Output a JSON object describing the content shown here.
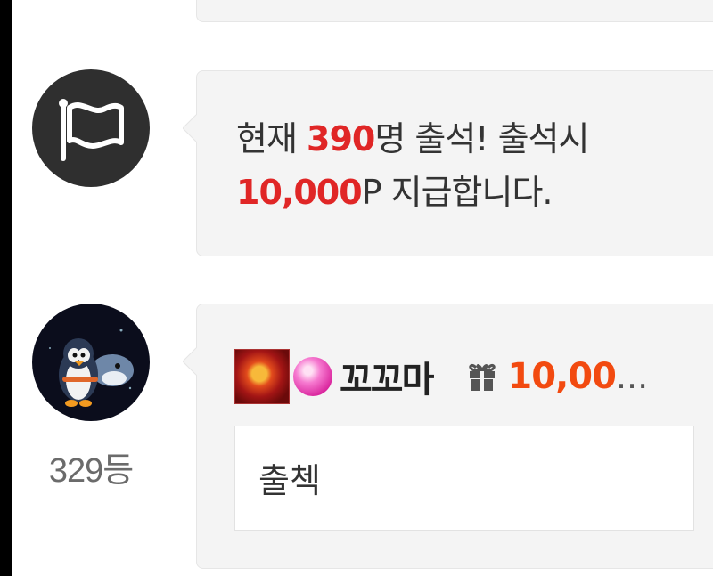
{
  "notice": {
    "icon": "flag-icon",
    "prefix": "현재 ",
    "count": "390",
    "middle": "명 출석! 출석시",
    "points": "10,000",
    "suffix": "P 지급합니다."
  },
  "comment": {
    "avatar_icon": "penguin-avatar",
    "rank": "329등",
    "level_icon": "dragon-level-icon",
    "gem_icon": "pink-gem-icon",
    "nickname": "꼬꼬마",
    "gift_icon": "gift-icon",
    "gift_amount": "10,00",
    "ellipsis": "...",
    "text": "출첵"
  },
  "colors": {
    "highlight": "#e02626",
    "gift": "#f24a10",
    "card_bg": "#f4f4f4"
  }
}
